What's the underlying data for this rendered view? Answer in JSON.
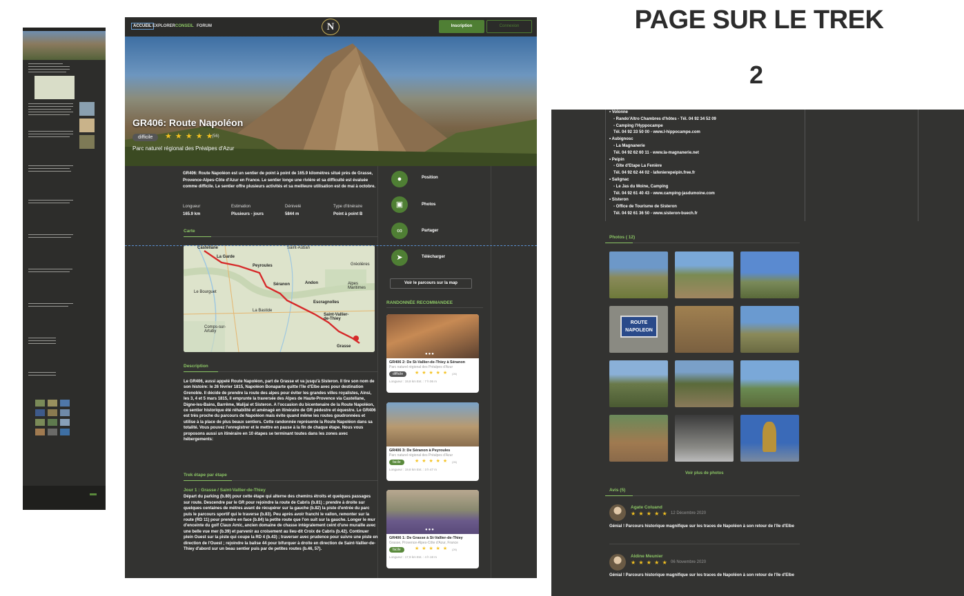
{
  "nav": {
    "accueil": "ACCUEIL",
    "explorer": "EXPLORER",
    "conseil": "CONSEIL",
    "forum": "FORUM",
    "logo": "N",
    "inscription": "Inscription",
    "connexion": "Connexion"
  },
  "hero": {
    "title": "GR406: Route Napoléon",
    "difficulty": "difficile",
    "stars": "★ ★ ★ ★ ★",
    "review_count": "(56)",
    "park": "Parc naturel régional des Préalpes d'Azur"
  },
  "overview": {
    "text": "GR406: Route Napoléon est un sentier de point à point de 165.9 kilomètres situé près de Grasse, Provence-Alpes-Côte d'Azur en France. Le sentier longe une rivière et sa difficulté est évaluée comme difficile. Le sentier offre plusieurs activités et sa meilleure utilisation est de mai à octobre.",
    "stats": [
      {
        "label": "Longueur",
        "value": "165.9 km"
      },
      {
        "label": "Estimation",
        "value": "Plusieurs - jours"
      },
      {
        "label": "Dénivelé",
        "value": "5844 m"
      },
      {
        "label": "Type d'itinéraire",
        "value": "Point à point B"
      }
    ]
  },
  "sections": {
    "carte": "Carte",
    "description": "Description",
    "trek_etape": "Trek étape par étape",
    "recommandee": "RANDONNÉE RECOMMANDEE"
  },
  "map_labels": {
    "castellane": "Castellane",
    "lagarde": "La Garde",
    "peyroules": "Peyroules",
    "seranon": "Séranon",
    "andon": "Andon",
    "escragnolles": "Escragnolles",
    "saintvallier": "Saint-Vallier-de-Thiey",
    "grasse": "Grasse",
    "gréolières": "Gréolières",
    "alpesmaritimes": "Alpes Maritimes",
    "labastide": "La Bastide",
    "lebourguet": "Le Bourguet",
    "comps": "Comps-sur-Artuby",
    "saintauban": "Saint-Auban"
  },
  "description": "Le GR406, aussi appelé Route Napoléon, part de Grasse et va jusqu'à Sisteron. Il tire son nom de son histoire: le 26 février 1815, Napoléon Bonaparte quitte l'île d'Elbe avec pour destination Grenoble. Il décide de prendre la route des alpes pour éviter les grandes villes royalistes, Ainsi, les 3, 4 et 5 mars 1815, il emprunte la traversée des Alpes de Haute-Provence via Castellane, Digne-les-Bains, Barrême, Malijai et Sisteron. A l'occasion du bicentenaire de la Route Napoléon, ce sentier historique été réhabilité et aménagé en itinéraire de GR pédestre et équestre. Le GR406 est très proche du parcours de Napoléon mais évite quand même les routes goudronnées et utilise à la place de plus beaux sentiers. Cette randonnée représente la Route Napoléon dans sa totalité. Vous pouvez l'enregistrer et le mettre en pause à la fin de chaque étape. Nous vous proposons aussi un itinéraire en 10 étapes se terminant toutes dans les zones avec hébergements:",
  "trek_day": {
    "title": "Jour 1 : Grasse / Saint-Vallier-de-Thiey",
    "text": "Départ du parking (b.80) pour cette étape qui alterne des chemins étroits et quelques passages sur route. Descendre par le GR pour rejoindre la route de Cabris (b.81) ; prendre à droite sur quelques centaines de mètres avant de récupérer sur la gauche (b.82) la piste d'entrée du parc puis le parcours sportif qui le traverse (b.83). Peu après avoir franchi le vallon, remonter sur la route (RD 11) pour prendre en face (b.84) la petite route que l'on suit sur la gauche. Longer le mur d'enceinte du golf Claux Amic, ancien domaine de chasse intégralement ceint d'une muraille avec une belle vue mer (b.39) et parvenir au croisement au lieu-dit Croix de Cabris (b.42). Continuer plein Ouest sur la piste qui coupe la RD 4 (b.43) ; traverser avec prudence pour suivre une piste en direction de l'Ouest ; rejoindre la balise 44 pour bifurquer à droite en direction de Saint-Vallier-de-Thiey d'abord sur un beau sentier puis par de petites routes (b.46, 57)."
  },
  "actions": {
    "position": "Position",
    "photos": "Photos",
    "partager": "Partager",
    "telecharger": "Télécharger",
    "voir_map": "Voir le parcours sur la map"
  },
  "cards": [
    {
      "title": "GR406 2: De St-Vallier-de-Thiey à Séranon",
      "park": "Parc naturel régional des Préalpes d'Azur",
      "badge": "difficile",
      "stars": "★ ★ ★ ★ ★",
      "count": "(26)",
      "stats": "Longueur : 19,8 km        Est. : 7 h 06 m"
    },
    {
      "title": "GR406 3: De Séranon à Peyroules",
      "park": "Parc naturel régional des Préalpes d'Azur",
      "badge": "facile",
      "stars": "★ ★ ★ ★ ★",
      "count": "(26)",
      "stats": "Longueur : 19,8 km        Est. : 3 h 47 m"
    },
    {
      "title": "GR406 1: De Grasse à St-Vallier-de-Thiey",
      "park": "Grasse, Provence-Alpes-Côte d'Azur, France",
      "badge": "facile",
      "stars": "★ ★ ★ ★ ★",
      "count": "(26)",
      "stats": "Longueur : 17,9 km        Est. : 4 h 18 m"
    }
  ],
  "panel": {
    "title": "PAGE SUR LE TREK",
    "number": "2",
    "lodging": [
      "• Volonne",
      "  - Rando'Altro Chambres d'hôtes - Tél. 04 92 34 52 09",
      "  - Camping l'Hyppocampe",
      "  Tél. 04 92 33 50 00 - www.l-hippocampe.com",
      "• Aubignosc",
      "  - La Magnanerie",
      "  Tél. 04 92 62 60 11 - www.la-magnanerie.net",
      "• Peipin",
      "  - Gîte d'Etape La Fenière",
      "  Tél. 04 92 62 44 02 - lafenierepeipin.free.fr",
      "• Salignac",
      "  - Le Jas du Moine, Camping",
      "  Tél. 04 92 61 40 43 - www.camping-jasdumoine.com",
      "• Sisteron",
      "  - Office de Tourisme de Sisteron",
      "  Tél. 04 92 61 36 50 - www.sisteron-buech.fr"
    ],
    "photos_title": "Photos ( 12)",
    "voir_plus": "Voir plus de photos",
    "avis_title": "Avis (5)",
    "reviews": [
      {
        "name": "Agate Coluand",
        "stars": "★ ★ ★ ★ ★",
        "date": "12 Décembre 2020",
        "text": "Génial ! Parcours historique magnifique sur les traces de Napoléon à son retour de l'île d'Elbe"
      },
      {
        "name": "Aldine Meunier",
        "stars": "★ ★ ★ ★ ★",
        "date": "06 Novembre 2020",
        "text": "Génial ! Parcours historique magnifique sur les traces de Napoléon à son retour de l'île d'Elbe"
      }
    ]
  },
  "colors": {
    "accent": "#8cc665",
    "button": "#4f7f34",
    "background": "#333331",
    "star": "#f4c221"
  }
}
